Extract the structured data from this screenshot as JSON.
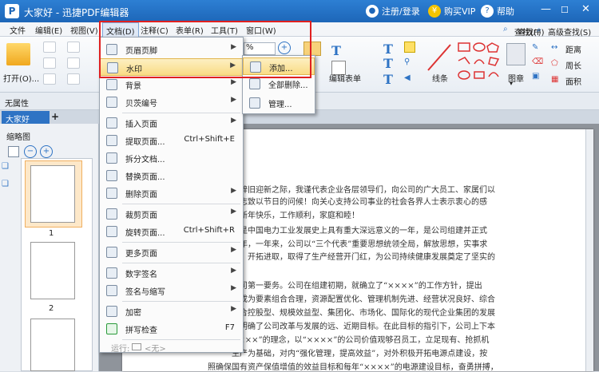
{
  "titlebar": {
    "logo": "P",
    "title": "大家好 - 迅捷PDF编辑器",
    "register": "注册/登录",
    "buy": "购买VIP",
    "help": "帮助",
    "yen": "¥",
    "q": "?"
  },
  "menubar": [
    "文件",
    "编辑(E)",
    "视图(V)",
    "文档(D)",
    "注释(C)",
    "表单(R)",
    "工具(T)",
    "窗口(W)"
  ],
  "ribbon": {
    "open": "打开(O)...",
    "zoom": "%",
    "edit_form": "编辑表单",
    "line": "线条",
    "picture": "图章",
    "find": "查找(F)",
    "adv_find": "高级查找(S)",
    "distance": "距离",
    "perimeter": "周长",
    "area": "面积"
  },
  "propbar": {
    "label": "无属性"
  },
  "tab": {
    "name": "大家好",
    "add": "+"
  },
  "sidebar": {
    "title": "缩略图",
    "page1": "1",
    "page2": "2"
  },
  "menu": {
    "items": [
      {
        "label": "页眉页脚",
        "shortcut": "",
        "arrow": true
      },
      {
        "label": "水印",
        "shortcut": "",
        "arrow": true
      },
      {
        "label": "背景",
        "shortcut": "",
        "arrow": true
      },
      {
        "label": "贝茨编号",
        "shortcut": "",
        "arrow": true
      },
      {
        "label": "插入页面",
        "shortcut": "",
        "arrow": true
      },
      {
        "label": "提取页面...",
        "shortcut": "Ctrl+Shift+E",
        "arrow": false
      },
      {
        "label": "拆分文档...",
        "shortcut": "",
        "arrow": false
      },
      {
        "label": "替换页面...",
        "shortcut": "",
        "arrow": false
      },
      {
        "label": "删除页面",
        "shortcut": "",
        "arrow": true
      },
      {
        "label": "裁剪页面",
        "shortcut": "",
        "arrow": true
      },
      {
        "label": "旋转页面...",
        "shortcut": "Ctrl+Shift+R",
        "arrow": false
      },
      {
        "label": "更多页面",
        "shortcut": "",
        "arrow": true
      },
      {
        "label": "数字签名",
        "shortcut": "",
        "arrow": true
      },
      {
        "label": "签名与缩写",
        "shortcut": "",
        "arrow": true
      },
      {
        "label": "加密",
        "shortcut": "",
        "arrow": true
      },
      {
        "label": "拼写检查",
        "shortcut": "F7",
        "arrow": false
      }
    ],
    "run_label": "运行:",
    "run_value": "<无>"
  },
  "submenu": [
    "添加...",
    "全部删除...",
    "管理..."
  ],
  "document": {
    "lines": [
      "这辞旧迎新之际，我谨代表企业各层领导们，向公司的广大员工、家属们以",
      "同志致以节日的问候！向关心支持公司事业的社会各界人士表示衷心的感",
      "家新年快乐，工作顺利，家庭和睦！",
      "，是中国电力工业发展史上具有重大深远意义的一年，是公司组建并正式",
      "一年，一年来，公司以“三个代表”重要思想统领全局，解放思想，实事求",
      "进，开拓进取，取得了生产经营开门红，为公司持续健康发展奠定了坚实的",
      "公司第一要务。公司在组建初期，就确立了“××××”的工作方针，提出",
      "设成为要素组合合理，资源配置优化、管理机制先进、经营状况良好、综合",
      "复合控股型、规模效益型、集团化、市场化、国际化的现代企业集团的发展",
      "并明确了公司改革与发展的远、近期目标。在此目标的指引下，公司上下本",
      "××××”的理念，以“××××”的公司价值观够召员工，立足现有、抢抓机",
      "生产为基础，对内“强化管理，提高效益”，对外积极开拓电源点建设，按",
      "照确保国有资产保值增值的效益目标和每年“××××”的电源建设目标，奋勇拼搏，"
    ]
  }
}
